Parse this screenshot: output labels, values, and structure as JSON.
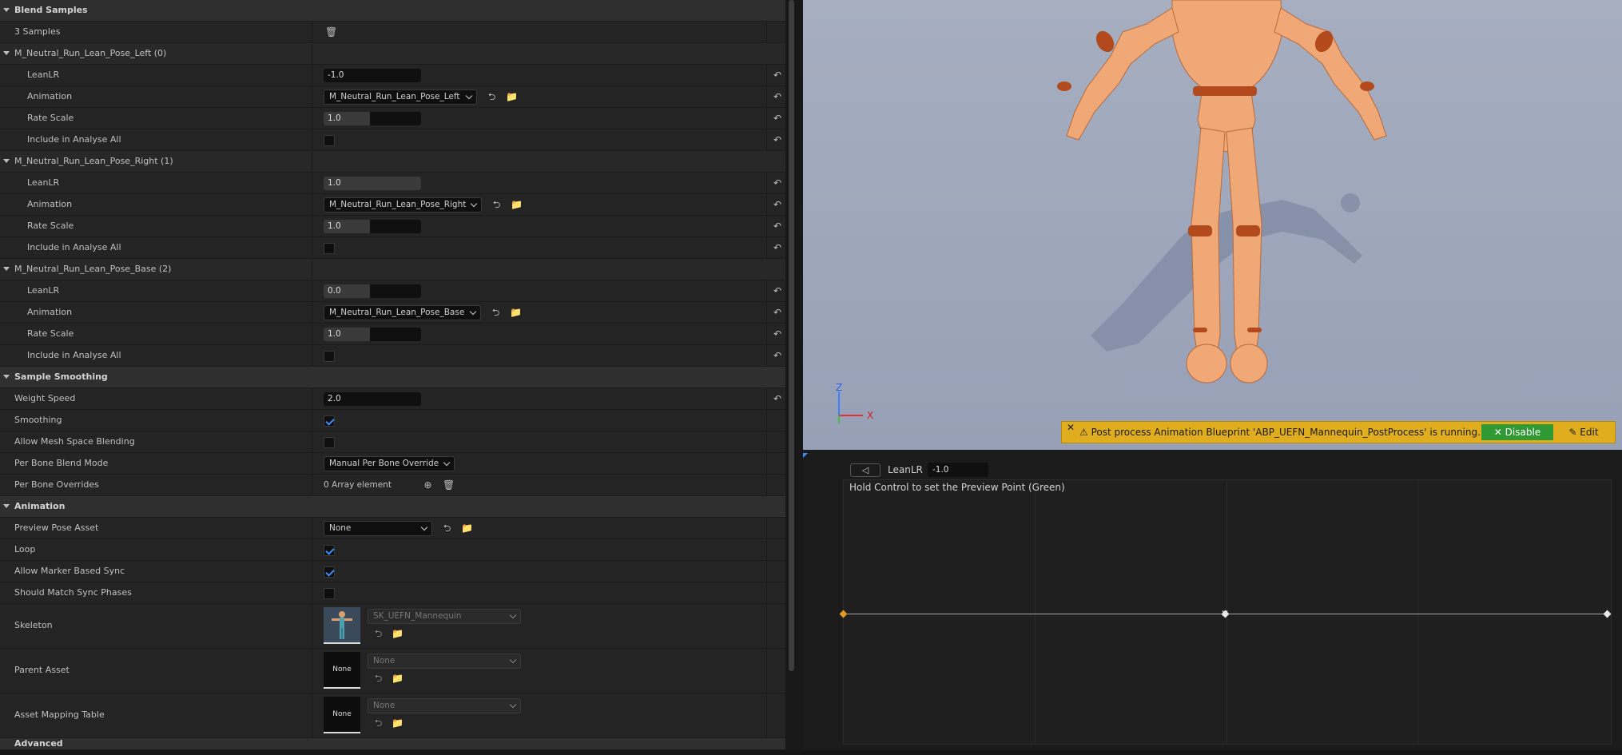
{
  "details": {
    "blend_samples": {
      "title": "Blend Samples",
      "count": "3 Samples",
      "samples": [
        {
          "header": "M_Neutral_Run_Lean_Pose_Left (0)",
          "lean_label": "LeanLR",
          "lean": "-1.0",
          "anim_label": "Animation",
          "anim": "M_Neutral_Run_Lean_Pose_Left",
          "rate_label": "Rate Scale",
          "rate": "1.0",
          "incl_label": "Include in Analyse All"
        },
        {
          "header": "M_Neutral_Run_Lean_Pose_Right (1)",
          "lean_label": "LeanLR",
          "lean": "1.0",
          "anim_label": "Animation",
          "anim": "M_Neutral_Run_Lean_Pose_Right",
          "rate_label": "Rate Scale",
          "rate": "1.0",
          "incl_label": "Include in Analyse All"
        },
        {
          "header": "M_Neutral_Run_Lean_Pose_Base (2)",
          "lean_label": "LeanLR",
          "lean": "0.0",
          "anim_label": "Animation",
          "anim": "M_Neutral_Run_Lean_Pose_Base",
          "rate_label": "Rate Scale",
          "rate": "1.0",
          "incl_label": "Include in Analyse All"
        }
      ]
    },
    "sample_smoothing": {
      "title": "Sample Smoothing",
      "weight_speed_label": "Weight Speed",
      "weight_speed": "2.0",
      "smoothing_label": "Smoothing",
      "allow_mesh_label": "Allow Mesh Space Blending",
      "per_bone_mode_label": "Per Bone Blend Mode",
      "per_bone_mode": "Manual Per Bone Override",
      "per_bone_overrides_label": "Per Bone Overrides",
      "per_bone_overrides": "0 Array element"
    },
    "animation": {
      "title": "Animation",
      "preview_pose_label": "Preview Pose Asset",
      "preview_pose": "None",
      "loop_label": "Loop",
      "marker_sync_label": "Allow Marker Based Sync",
      "match_sync_label": "Should Match Sync Phases",
      "skeleton_label": "Skeleton",
      "skeleton": "SK_UEFN_Mannequin",
      "parent_label": "Parent Asset",
      "parent": "None",
      "parent_thumb": "None",
      "mapping_label": "Asset Mapping Table",
      "mapping": "None",
      "mapping_thumb": "None"
    },
    "advanced": "Advanced"
  },
  "viewport": {
    "axis_z": "Z",
    "axis_x": "X",
    "notification": {
      "text": "⚠  Post process Animation Blueprint 'ABP_UEFN_Mannequin_PostProcess' is running.",
      "disable": "✕ Disable",
      "edit": "✎ Edit"
    }
  },
  "blendspace": {
    "axis_label": "LeanLR",
    "axis_value": "-1.0",
    "hint": "Hold Control to set the Preview Point (Green)",
    "preview_position": 0.5,
    "samples": [
      -1.0,
      0.0,
      1.0
    ]
  },
  "colors": {
    "accent": "#3b8eff",
    "warning": "#e0ad1e",
    "disable_button": "#2f9a34",
    "skin": "#f0a877",
    "joints": "#b24a1e"
  }
}
